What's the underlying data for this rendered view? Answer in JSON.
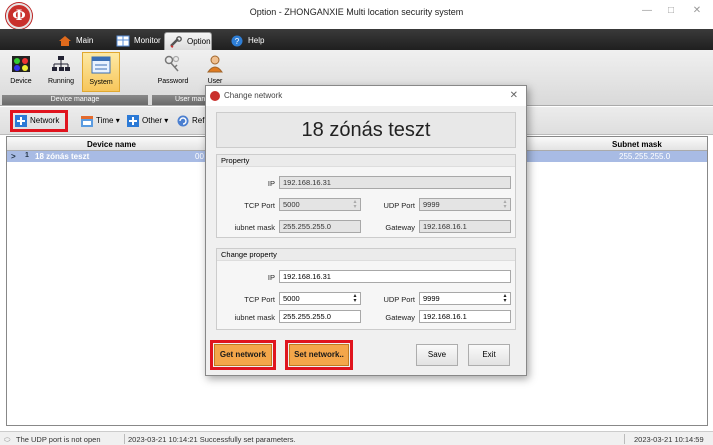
{
  "window": {
    "logo_text": "Ф",
    "title": "Option - ZHONGANXIE Multi location security system",
    "minimize": "—",
    "maximize": "□",
    "close": "✕"
  },
  "tabs": [
    {
      "label": "Main",
      "icon": "home-icon"
    },
    {
      "label": "Monitor",
      "icon": "monitor-icon"
    },
    {
      "label": "Option",
      "icon": "wrench-icon"
    },
    {
      "label": "Help",
      "icon": "help-icon"
    }
  ],
  "ribbon": {
    "device_manage": {
      "label": "Device manage",
      "buttons": [
        "Device",
        "Running",
        "System"
      ]
    },
    "user_manage": {
      "label": "User manage",
      "buttons": [
        "Password",
        "User"
      ]
    }
  },
  "toolbar": {
    "network": "Network",
    "time": "Time",
    "other": "Other",
    "refresh": "Refre"
  },
  "grid": {
    "columns": {
      "device_name": "Device name",
      "subnet_mask": "Subnet mask"
    },
    "rows": [
      {
        "expander": ">",
        "index": "1",
        "name": "18 zónás teszt",
        "id_fragment": "00",
        "subnet": "255.255.255.0"
      }
    ]
  },
  "status": {
    "udp": "The UDP port is not open",
    "message": "2023-03-21 10:14:21 Successfully set parameters.",
    "clock": "2023-03-21 10:14:59"
  },
  "dialog": {
    "title": "Change network",
    "close": "✕",
    "device_title": "18 zónás teszt",
    "property": {
      "heading": "Property",
      "ip_label": "IP",
      "ip": "192.168.16.31",
      "tcp_label": "TCP Port",
      "tcp": "5000",
      "udp_label": "UDP Port",
      "udp": "9999",
      "subnet_label": "iubnet mask",
      "subnet": "255.255.255.0",
      "gateway_label": "Gateway",
      "gateway": "192.168.16.1"
    },
    "change": {
      "heading": "Change property",
      "ip_label": "IP",
      "ip": "192.168.16.31",
      "tcp_label": "TCP Port",
      "tcp": "5000",
      "udp_label": "UDP Port",
      "udp": "9999",
      "subnet_label": "iubnet mask",
      "subnet": "255.255.255.0",
      "gateway_label": "Gateway",
      "gateway": "192.168.16.1"
    },
    "buttons": {
      "get": "Get network",
      "set": "Set network..",
      "save": "Save",
      "exit": "Exit"
    }
  },
  "colors": {
    "highlight_frame": "#e0141e",
    "selected_row": "#a8bbe4",
    "orange_button": "#f4a64a"
  }
}
